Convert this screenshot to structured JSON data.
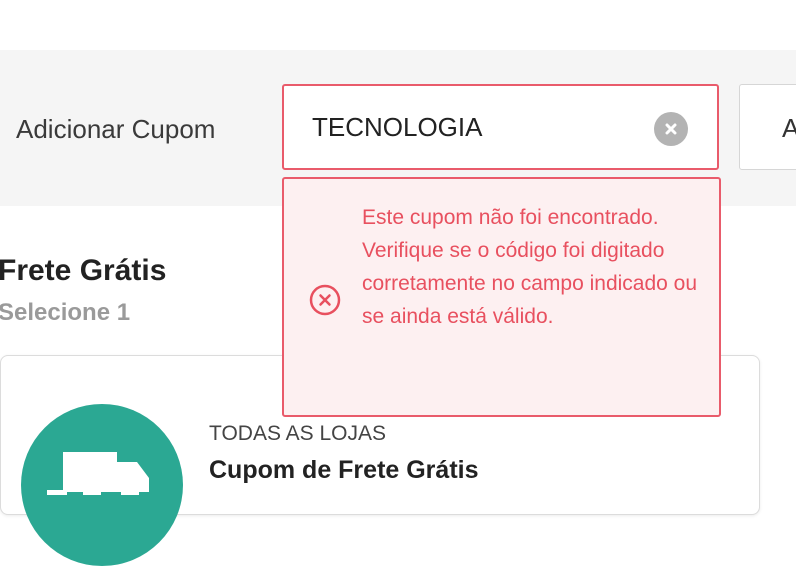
{
  "coupon_bar": {
    "label": "Adicionar Cupom",
    "input_value": "TECNOLOGIA",
    "apply_label": "Aplicar"
  },
  "error": {
    "message": "Este cupom não foi encontrado. Verifique se o código foi digitado corretamente no campo indicado ou se ainda está válido."
  },
  "section": {
    "title": "Frete Grátis",
    "subtitle": "Selecione 1"
  },
  "coupon_card": {
    "store": "TODAS AS LOJAS",
    "name": "Cupom de Frete Grátis",
    "icon": "truck-icon"
  },
  "colors": {
    "error": "#e8505f",
    "accent_green": "#2ba893"
  }
}
